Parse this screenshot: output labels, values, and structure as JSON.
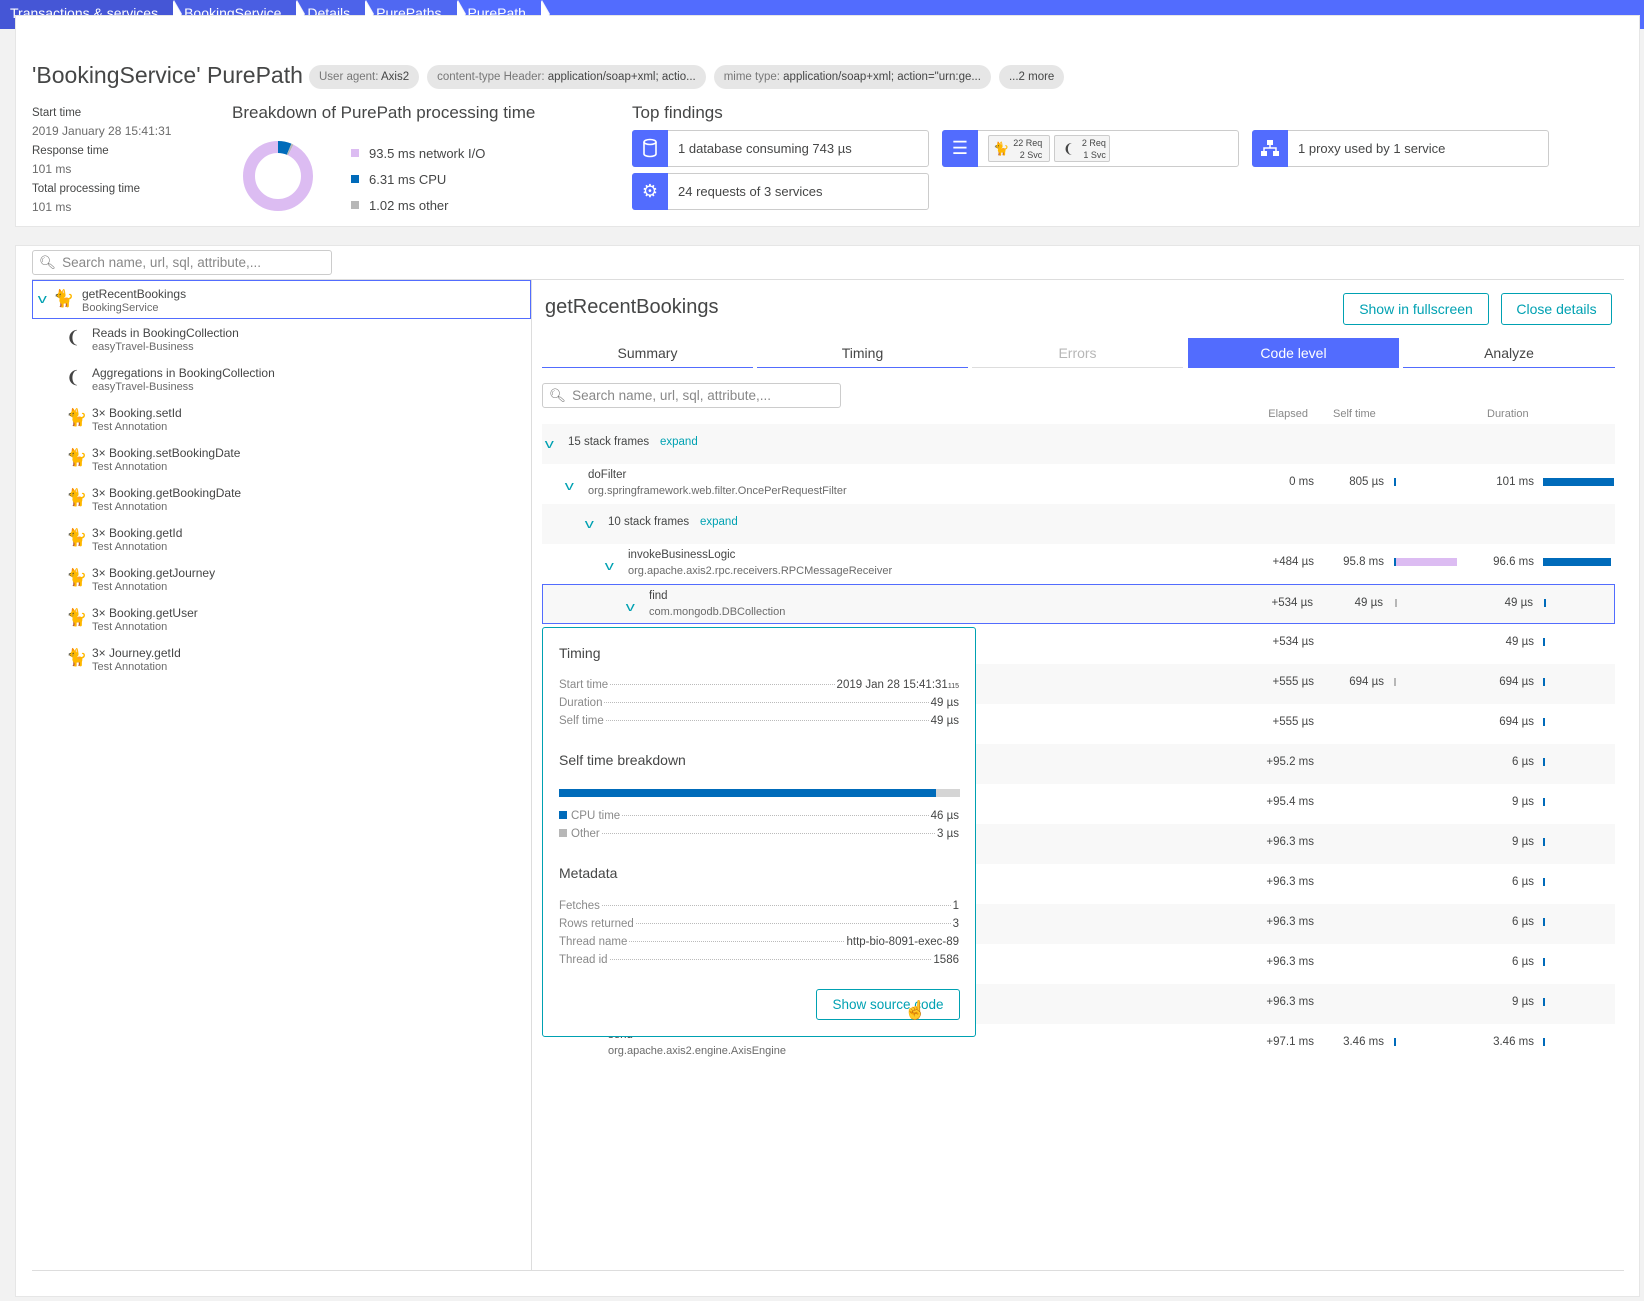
{
  "breadcrumb": [
    "Transactions & services",
    "BookingService",
    "Details",
    "PurePaths",
    "PurePath"
  ],
  "header": {
    "title": "'BookingService' PurePath",
    "pills": [
      {
        "k": "User agent: ",
        "v": "Axis2"
      },
      {
        "k": "content-type Header: ",
        "v": "application/soap+xml; actio..."
      },
      {
        "k": "mime type: ",
        "v": "application/soap+xml; action=\"urn:ge..."
      },
      {
        "k": "",
        "v": "...2 more"
      }
    ],
    "start_label": "Start time",
    "start_value": "2019 January 28 15:41:31",
    "response_label": "Response time",
    "response_value": "101 ms",
    "total_label": "Total processing time",
    "total_value": "101 ms"
  },
  "breakdown": {
    "title": "Breakdown of PurePath processing time",
    "items": [
      {
        "label": "93.5 ms network I/O",
        "value": 93.5,
        "color": "#dcbcf2"
      },
      {
        "label": "6.31 ms CPU",
        "value": 6.31,
        "color": "#006bba"
      },
      {
        "label": "1.02 ms other",
        "value": 1.02,
        "color": "#b7b7b7"
      }
    ]
  },
  "findings": {
    "title": "Top findings",
    "database": "1 database consuming 743 µs",
    "requests": "24 requests of 3 services",
    "svc1_req": "22 Req",
    "svc1_svc": "2 Svc",
    "svc2_req": "2 Req",
    "svc2_svc": "1 Svc",
    "proxy": "1 proxy used by 1 service"
  },
  "left": {
    "search_placeholder": "Search name, url, sql, attribute,...",
    "items": [
      {
        "name": "getRecentBookings",
        "sub": "BookingService",
        "icon": "tomcat"
      },
      {
        "name": "Reads in BookingCollection",
        "sub": "easyTravel-Business",
        "icon": "mongodb"
      },
      {
        "name": "Aggregations in BookingCollection",
        "sub": "easyTravel-Business",
        "icon": "mongodb"
      },
      {
        "name": "3× Booking.setId",
        "sub": "Test Annotation",
        "icon": "tomcat"
      },
      {
        "name": "3× Booking.setBookingDate",
        "sub": "Test Annotation",
        "icon": "tomcat"
      },
      {
        "name": "3× Booking.getBookingDate",
        "sub": "Test Annotation",
        "icon": "tomcat"
      },
      {
        "name": "3× Booking.getId",
        "sub": "Test Annotation",
        "icon": "tomcat"
      },
      {
        "name": "3× Booking.getJourney",
        "sub": "Test Annotation",
        "icon": "tomcat"
      },
      {
        "name": "3× Booking.getUser",
        "sub": "Test Annotation",
        "icon": "tomcat"
      },
      {
        "name": "3× Journey.getId",
        "sub": "Test Annotation",
        "icon": "tomcat"
      }
    ]
  },
  "detail": {
    "title": "getRecentBookings",
    "fullscreen": "Show in fullscreen",
    "close": "Close details",
    "tabs": [
      "Summary",
      "Timing",
      "Errors",
      "Code level",
      "Analyze"
    ],
    "active_tab": "Code level",
    "search_placeholder": "Search name, url, sql, attribute,...",
    "columns": {
      "elapsed": "Elapsed",
      "self": "Self time",
      "duration": "Duration"
    },
    "rows": [
      {
        "frames": "15 stack frames",
        "expand": "expand",
        "level": 0
      },
      {
        "name": "doFilter",
        "cls": "org.springframework.web.filter.OncePerRequestFilter",
        "level": 1,
        "elapsed": "0 ms",
        "self": "805 µs",
        "self_frac": 0.008,
        "self_color": "#006bba",
        "dur": "101 ms",
        "dur_frac": 1.0
      },
      {
        "frames": "10 stack frames",
        "expand": "expand",
        "level": 2
      },
      {
        "name": "invokeBusinessLogic",
        "cls": "org.apache.axis2.rpc.receivers.RPCMessageReceiver",
        "level": 3,
        "elapsed": "+484 µs",
        "self": "95.8 ms",
        "self_frac": 0.95,
        "self_color": "#dcbcf2",
        "dur": "96.6 ms",
        "dur_frac": 0.956
      },
      {
        "name": "find",
        "cls": "com.mongodb.DBCollection",
        "level": 4,
        "elapsed": "+534 µs",
        "self": "49 µs",
        "self_frac": 0.0005,
        "self_color": "#b7b7b7",
        "dur": "49 µs",
        "dur_frac": 0.0005,
        "selected": true
      },
      {
        "elapsed": "+534 µs",
        "dur": "49 µs",
        "dur_frac": 0.0005
      },
      {
        "elapsed": "+555 µs",
        "self": "694 µs",
        "self_frac": 0.007,
        "self_color": "#b7b7b7",
        "dur": "694 µs",
        "dur_frac": 0.007
      },
      {
        "elapsed": "+555 µs",
        "dur": "694 µs",
        "dur_frac": 0.007
      },
      {
        "elapsed": "+95.2 ms",
        "dur": "6 µs",
        "dur_frac": 0.0001
      },
      {
        "elapsed": "+95.4 ms",
        "dur": "9 µs",
        "dur_frac": 0.0001
      },
      {
        "elapsed": "+96.3 ms",
        "dur": "9 µs",
        "dur_frac": 0.0001
      },
      {
        "elapsed": "+96.3 ms",
        "dur": "6 µs",
        "dur_frac": 0.0001
      },
      {
        "elapsed": "+96.3 ms",
        "dur": "6 µs",
        "dur_frac": 0.0001
      },
      {
        "elapsed": "+96.3 ms",
        "dur": "6 µs",
        "dur_frac": 0.0001
      },
      {
        "elapsed": "+96.3 ms",
        "dur": "9 µs",
        "dur_frac": 0.0001
      },
      {
        "name": "send",
        "cls": "org.apache.axis2.engine.AxisEngine",
        "level": 2,
        "elapsed": "+97.1 ms",
        "self": "3.46 ms",
        "self_frac": 0.034,
        "self_color": "#006bba",
        "dur": "3.46 ms",
        "dur_frac": 0.034
      }
    ]
  },
  "tooltip": {
    "timing_title": "Timing",
    "timing": [
      {
        "k": "Start time",
        "v": "2019 Jan 28 15:41:31",
        "ms": "115"
      },
      {
        "k": "Duration",
        "v": "49 µs"
      },
      {
        "k": "Self time",
        "v": "49 µs"
      }
    ],
    "breakdown_title": "Self time breakdown",
    "cpu_fraction": 0.939,
    "breakdown": [
      {
        "k": "CPU time",
        "v": "46 µs",
        "color": "#006bba"
      },
      {
        "k": "Other",
        "v": "3 µs",
        "color": "#b7b7b7"
      }
    ],
    "metadata_title": "Metadata",
    "metadata": [
      {
        "k": "Fetches",
        "v": "1"
      },
      {
        "k": "Rows returned",
        "v": "3"
      },
      {
        "k": "Thread name",
        "v": "http-bio-8091-exec-89"
      },
      {
        "k": "Thread id",
        "v": "1586"
      }
    ],
    "button": "Show source code"
  }
}
